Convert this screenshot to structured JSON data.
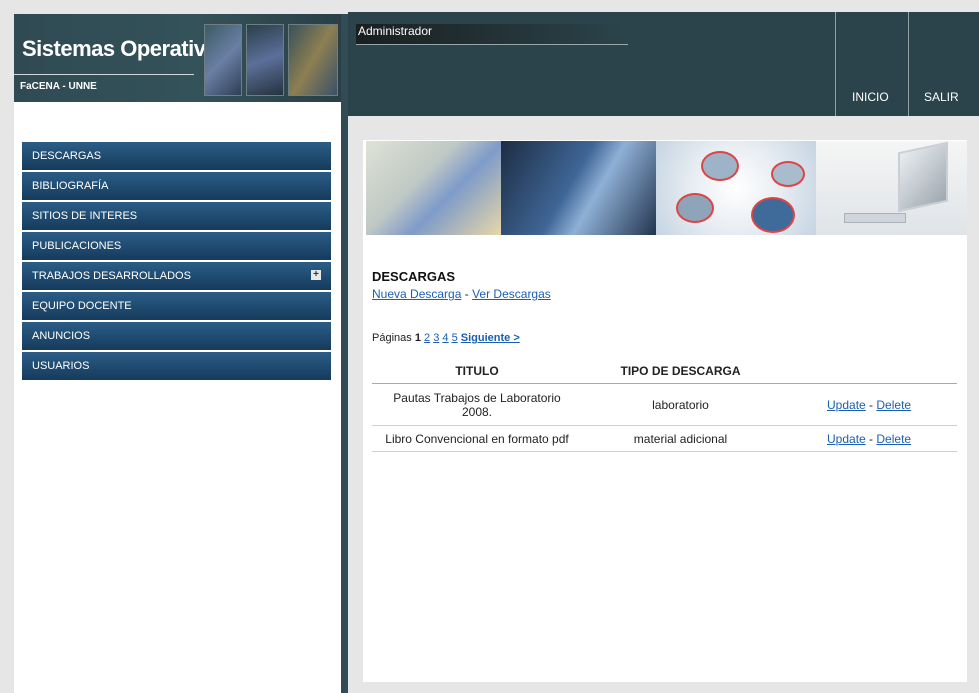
{
  "logo": {
    "title": "Sistemas Operativos",
    "subtitle": "FaCENA - UNNE"
  },
  "menu": [
    {
      "label": "DESCARGAS",
      "expand": false
    },
    {
      "label": "BIBLIOGRAFÍA",
      "expand": false
    },
    {
      "label": "SITIOS DE INTERES",
      "expand": false
    },
    {
      "label": "PUBLICACIONES",
      "expand": false
    },
    {
      "label": "TRABAJOS DESARROLLADOS",
      "expand": true
    },
    {
      "label": "EQUIPO DOCENTE",
      "expand": false
    },
    {
      "label": "ANUNCIOS",
      "expand": false
    },
    {
      "label": "USUARIOS",
      "expand": false
    }
  ],
  "header": {
    "user": "Administrador",
    "nav": {
      "inicio": "INICIO",
      "salir": "SALIR"
    }
  },
  "section": {
    "title": "DESCARGAS",
    "new_link": "Nueva Descarga",
    "separator": "-",
    "view_link": "Ver Descargas"
  },
  "pagination": {
    "label": "Páginas",
    "current": "1",
    "pages": [
      "2",
      "3",
      "4",
      "5"
    ],
    "next": "Siguiente >"
  },
  "table": {
    "headers": {
      "titulo": "TITULO",
      "tipo": "TIPO DE DESCARGA"
    },
    "rows": [
      {
        "titulo": "Pautas Trabajos de Laboratorio 2008.",
        "tipo": "laboratorio",
        "update": "Update",
        "sep": "-",
        "delete": "Delete"
      },
      {
        "titulo": "Libro Convencional en formato pdf",
        "tipo": "material adicional",
        "update": "Update",
        "sep": "-",
        "delete": "Delete"
      }
    ]
  },
  "colors": {
    "accent": "#2b444b",
    "menu": "#1f4a70",
    "link": "#1a5fb4"
  }
}
